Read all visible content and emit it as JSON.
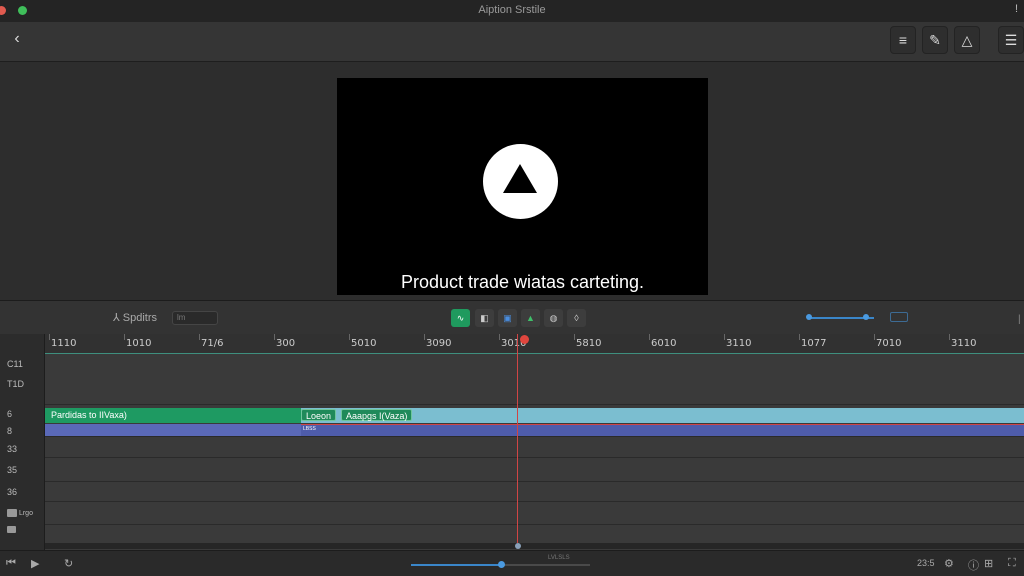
{
  "window": {
    "title": "Aiption Srstile",
    "traffic_colors": [
      "#e05a4f",
      "#3fbf5a"
    ]
  },
  "toolbar": {
    "back_icon": "chevron-left-icon",
    "right_icons": [
      "list-icon",
      "pen-icon",
      "warning-icon",
      "menu-icon"
    ]
  },
  "viewer": {
    "caption": "Product trade wiatas carteting."
  },
  "timeline_controls": {
    "split_label": "Spditrs",
    "split_value": "lm",
    "buttons": [
      "∿",
      "◧",
      "▣",
      "▲",
      "◍",
      "◊"
    ],
    "zoom_level": 0.88
  },
  "ruler": {
    "ticks": [
      "1110",
      "1010",
      "71/6",
      "300",
      "5010",
      "3090",
      "3010",
      "5810",
      "6010",
      "3110",
      "1077",
      "7010",
      "3110"
    ]
  },
  "track_headers": [
    "C11",
    "T1D",
    "6",
    "8",
    "33",
    "35",
    "36",
    "Lrgo"
  ],
  "clips": {
    "main_label": "Pardidas to IIVaxa)",
    "sub_clip_1": "Loeon",
    "sub_clip_2": "Aaapgs I(Vaza)",
    "small_text": "LBSS"
  },
  "colors": {
    "accent": "#3a86c9",
    "clip_green": "#1e9a62",
    "clip_teal": "#7bbed0",
    "clip_blue": "#5a69b8",
    "playhead": "#e0463e"
  },
  "bottom": {
    "scrub_label": "LVLSLS",
    "scrub_position": 0.5,
    "timecode": "23:5"
  }
}
